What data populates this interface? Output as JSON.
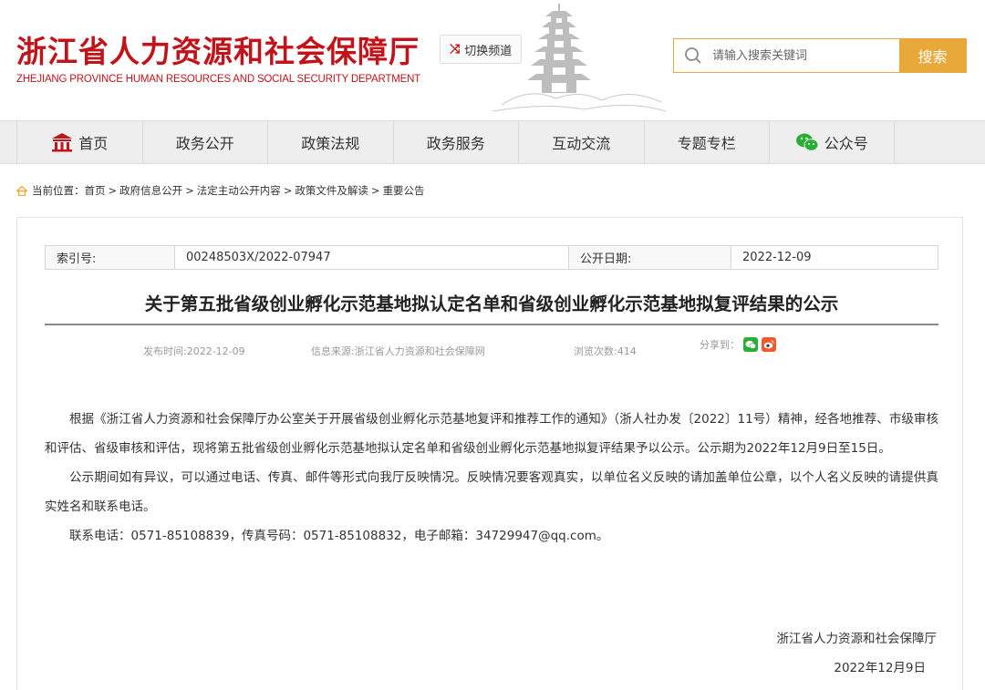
{
  "header": {
    "title_cn": "浙江省人力资源和社会保障厅",
    "title_en": "ZHEJIANG PROVINCE HUMAN RESOURCES AND SOCIAL SECURITY DEPARTMENT",
    "switch_label": "切换频道",
    "search_placeholder": "请输入搜索关键词",
    "search_button": "搜索"
  },
  "nav": {
    "items": [
      {
        "label": "首页",
        "icon": "home-icon"
      },
      {
        "label": "政务公开"
      },
      {
        "label": "政策法规"
      },
      {
        "label": "政务服务"
      },
      {
        "label": "互动交流"
      },
      {
        "label": "专题专栏"
      },
      {
        "label": "公众号",
        "icon": "wechat-icon"
      }
    ]
  },
  "breadcrumb": {
    "prefix": "当前位置：",
    "items": [
      "首页",
      "政府信息公开",
      "法定主动公开内容",
      "政策文件及解读",
      "重要公告"
    ],
    "separator": ">"
  },
  "article": {
    "meta": {
      "index_label": "索引号:",
      "index_value": "00248503X/2022-07947",
      "date_label": "公开日期:",
      "date_value": "2022-12-09"
    },
    "title": "关于第五批省级创业孵化示范基地拟认定名单和省级创业孵化示范基地拟复评结果的公示",
    "publish_time": "发布时间:2022-12-09",
    "source": "信息来源:浙江省人力资源和社会保障网",
    "views": "浏览次数:414",
    "share_label": "分享到：",
    "paragraphs": [
      "根据《浙江省人力资源和社会保障厅办公室关于开展省级创业孵化示范基地复评和推荐工作的通知》（浙人社办发〔2022〕11号）精神，经各地推荐、市级审核和评估、省级审核和评估，现将第五批省级创业孵化示范基地拟认定名单和省级创业孵化示范基地拟复评结果予以公示。公示期为2022年12月9日至15日。",
      "公示期间如有异议，可以通过电话、传真、邮件等形式向我厅反映情况。反映情况要客观真实，以单位名义反映的请加盖单位公章，以个人名义反映的请提供真实姓名和联系电话。",
      "联系电话：0571-85108839，传真号码：0571-85108832，电子邮箱：34729947@qq.com。"
    ],
    "signature_org": "浙江省人力资源和社会保障厅",
    "signature_date": "2022年12月9日"
  },
  "colors": {
    "brand_red": "#c0141a",
    "accent_orange": "#e8a83a",
    "nav_bg": "#eeeeee"
  }
}
